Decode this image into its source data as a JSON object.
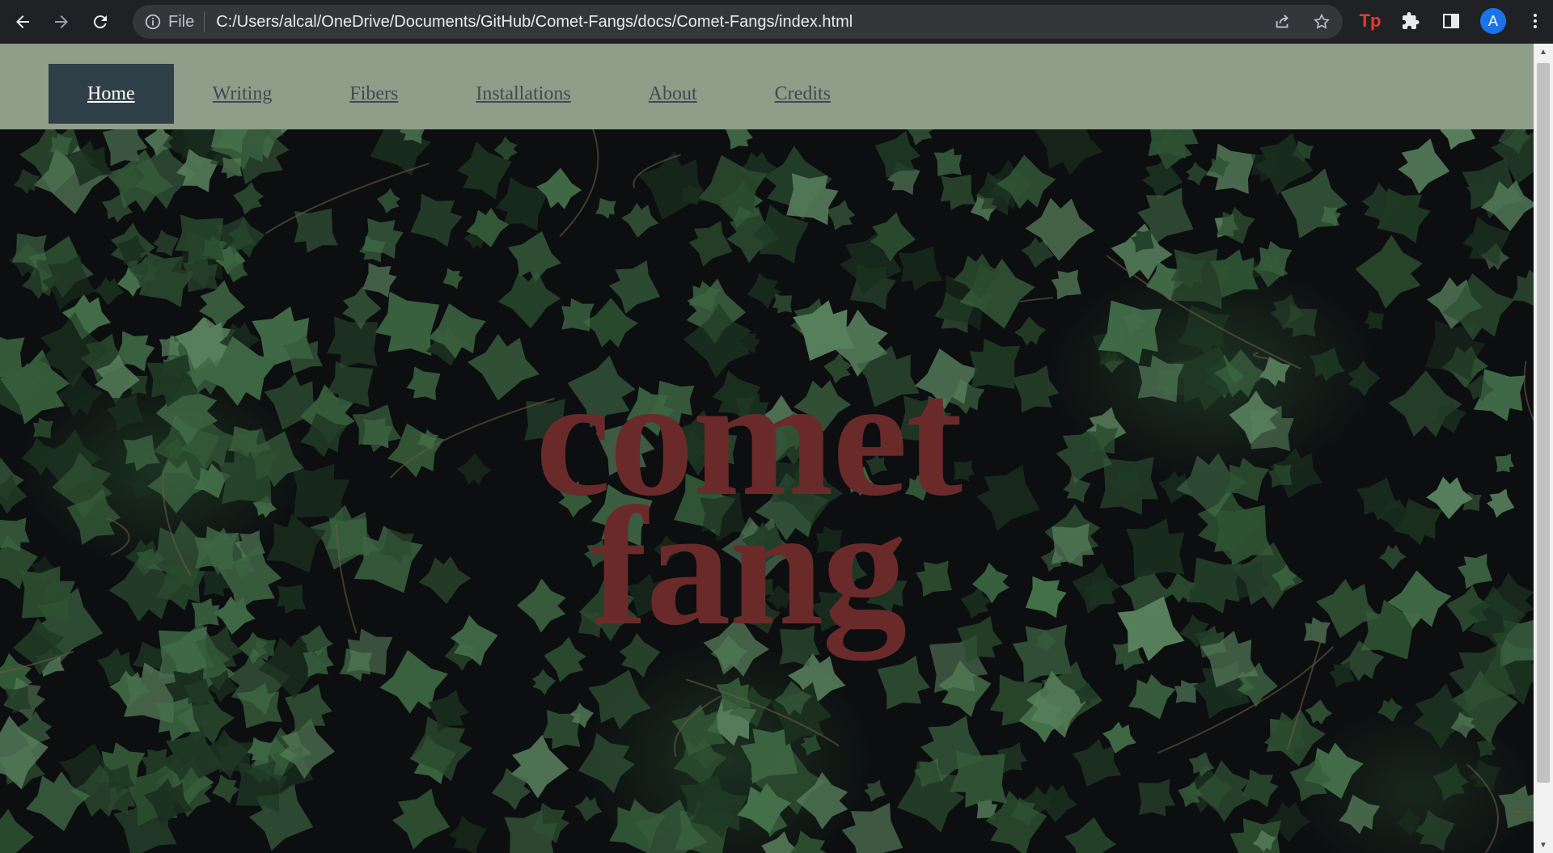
{
  "browser": {
    "scheme_label": "File",
    "url": "C:/Users/alcal/OneDrive/Documents/GitHub/Comet-Fangs/docs/Comet-Fangs/index.html",
    "extension_label": "Tp",
    "profile_initial": "A",
    "icons": [
      "back-icon",
      "forward-icon",
      "reload-icon",
      "info-icon",
      "share-icon",
      "star-icon",
      "extension-icon",
      "puzzle-icon",
      "side-panel-icon",
      "avatar",
      "menu-icon"
    ]
  },
  "site": {
    "nav": [
      {
        "label": "Home",
        "active": true
      },
      {
        "label": "Writing",
        "active": false
      },
      {
        "label": "Fibers",
        "active": false
      },
      {
        "label": "Installations",
        "active": false
      },
      {
        "label": "About",
        "active": false
      },
      {
        "label": "Credits",
        "active": false
      }
    ],
    "hero": {
      "title_line1": "comet",
      "title_line2": "fang"
    }
  },
  "colors": {
    "nav_bg": "#8e9e88",
    "nav_active_bg": "#2f3f47",
    "title": "#6b2a2a",
    "chrome_bg": "#202124"
  }
}
